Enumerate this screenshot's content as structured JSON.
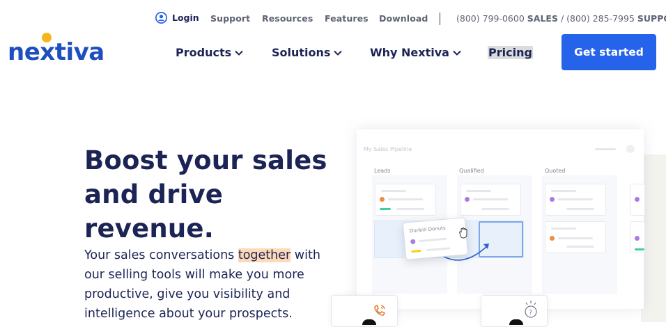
{
  "utility_bar": {
    "login": "Login",
    "links": [
      "Support",
      "Resources",
      "Features",
      "Download"
    ],
    "phone_sales_number": "(800) 799-0600",
    "phone_sales_label": "SALES",
    "phone_divider": "/",
    "phone_support_number": "(800) 285-7995",
    "phone_support_label": "SUPPORT"
  },
  "logo": {
    "text": "nextiva",
    "accent_color": "#f5b61c",
    "brand_color": "#1f4fbf"
  },
  "nav": {
    "items": [
      "Products",
      "Solutions",
      "Why Nextiva"
    ],
    "pricing": "Pricing",
    "cta": "Get started"
  },
  "hero": {
    "headline_line1": "Boost your sales",
    "headline_line2": "and drive revenue.",
    "para_before": "Your sales conversations ",
    "para_highlight": "together",
    "para_after": " with our selling tools will make you more productive, give you visibility and intelligence about your prospects."
  },
  "illustration": {
    "board_title": "My Sales Pipeline",
    "columns": [
      "Leads",
      "Qualified",
      "Quoted"
    ],
    "drag_card_title": "Dunkin Donuts"
  },
  "colors": {
    "primary_button": "#2563eb",
    "text_navy": "#1c2455",
    "highlight": "#fcd9b8"
  }
}
